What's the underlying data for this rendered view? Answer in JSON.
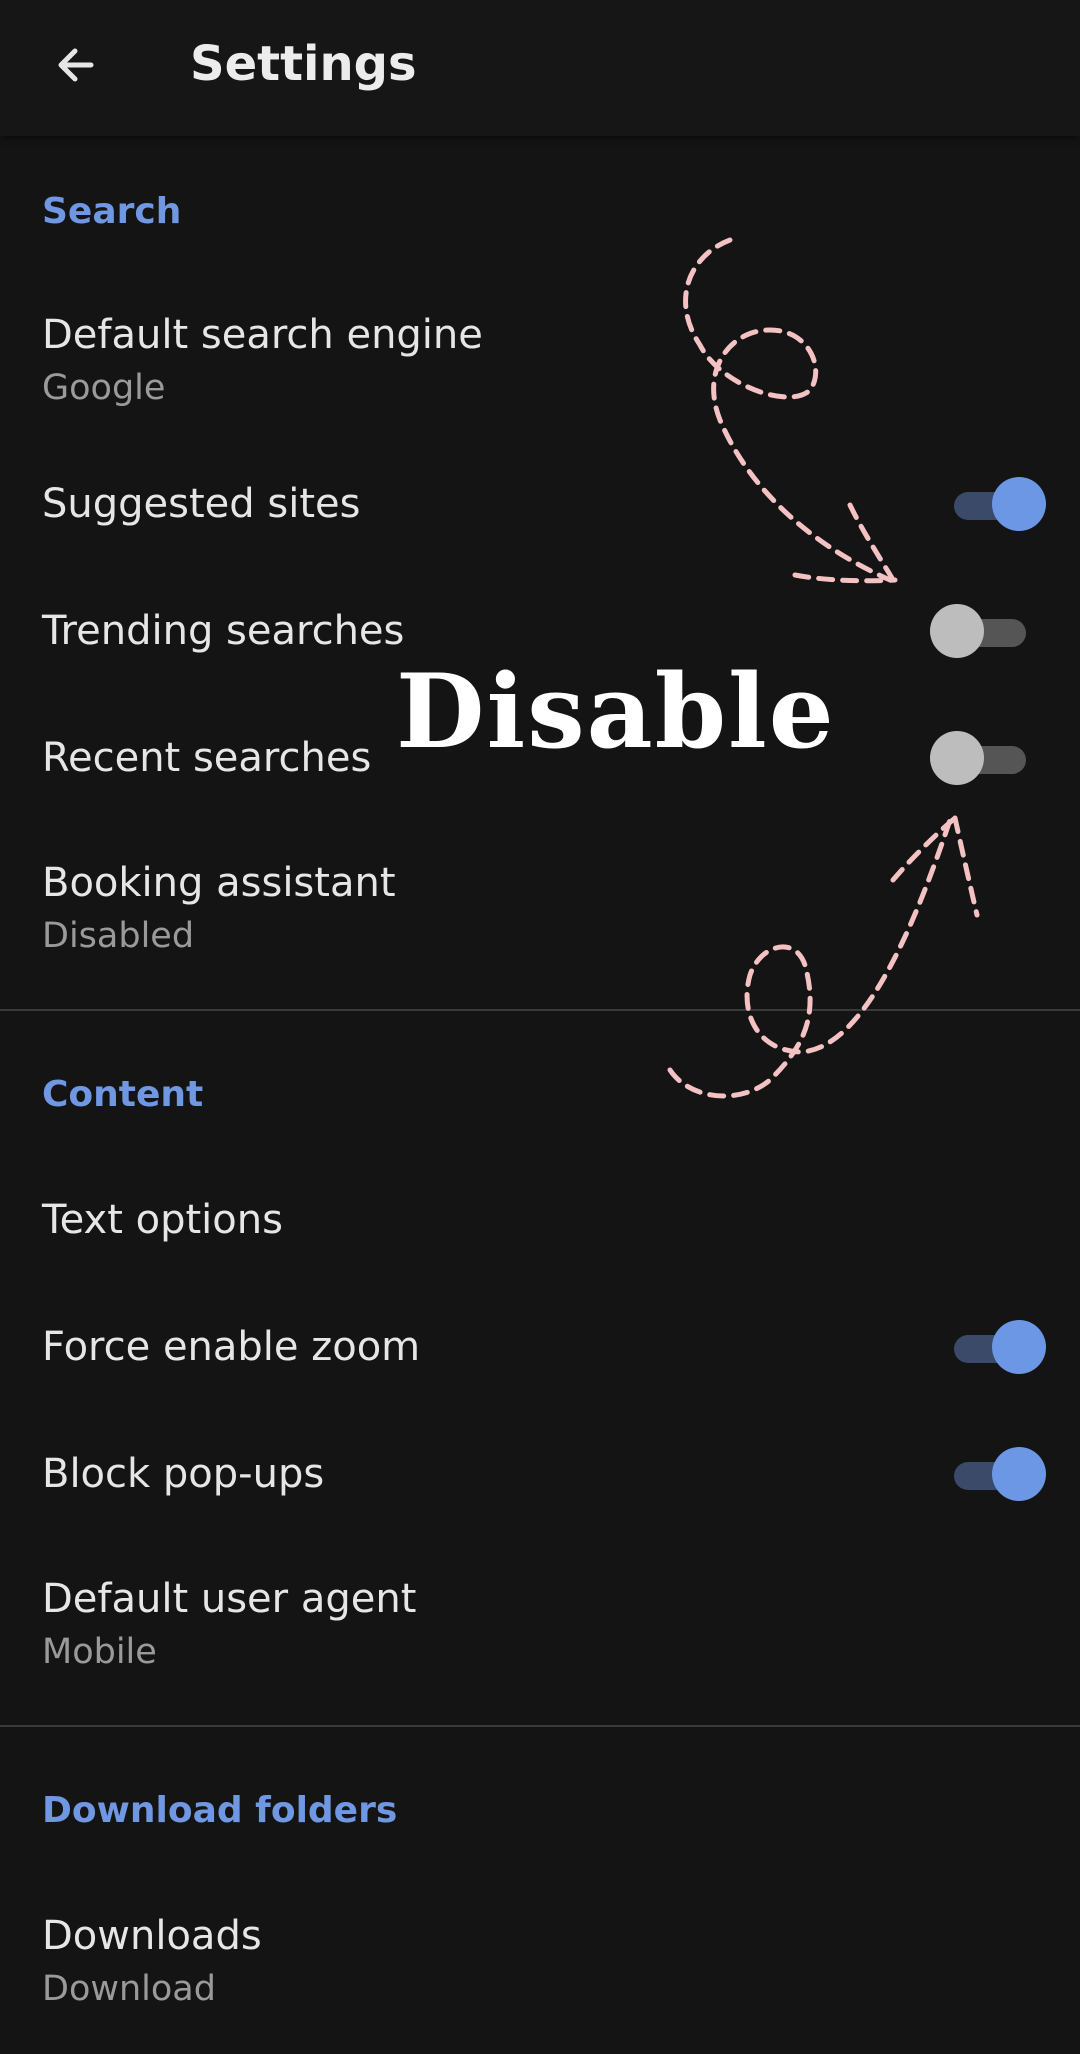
{
  "appbar": {
    "title": "Settings",
    "back_icon": "arrow-left-icon"
  },
  "sections": {
    "search": {
      "header": "Search",
      "default_search_engine": {
        "title": "Default search engine",
        "value": "Google"
      },
      "suggested_sites": {
        "title": "Suggested sites",
        "enabled": true
      },
      "trending_searches": {
        "title": "Trending searches",
        "enabled": false
      },
      "recent_searches": {
        "title": "Recent searches",
        "enabled": false
      },
      "booking_assistant": {
        "title": "Booking assistant",
        "value": "Disabled"
      }
    },
    "content": {
      "header": "Content",
      "text_options": {
        "title": "Text options"
      },
      "force_enable_zoom": {
        "title": "Force enable zoom",
        "enabled": true
      },
      "block_popups": {
        "title": "Block pop-ups",
        "enabled": true
      },
      "default_user_agent": {
        "title": "Default user agent",
        "value": "Mobile"
      }
    },
    "download_folders": {
      "header": "Download folders",
      "downloads": {
        "title": "Downloads",
        "value": "Download"
      }
    }
  },
  "annotation": {
    "text": "Disable",
    "arrow_color": "#f4c2c2"
  },
  "colors": {
    "background": "#141414",
    "accent": "#7098e2",
    "toggle_on_thumb": "#6c97e5",
    "toggle_off_thumb": "#bdbdbd"
  }
}
